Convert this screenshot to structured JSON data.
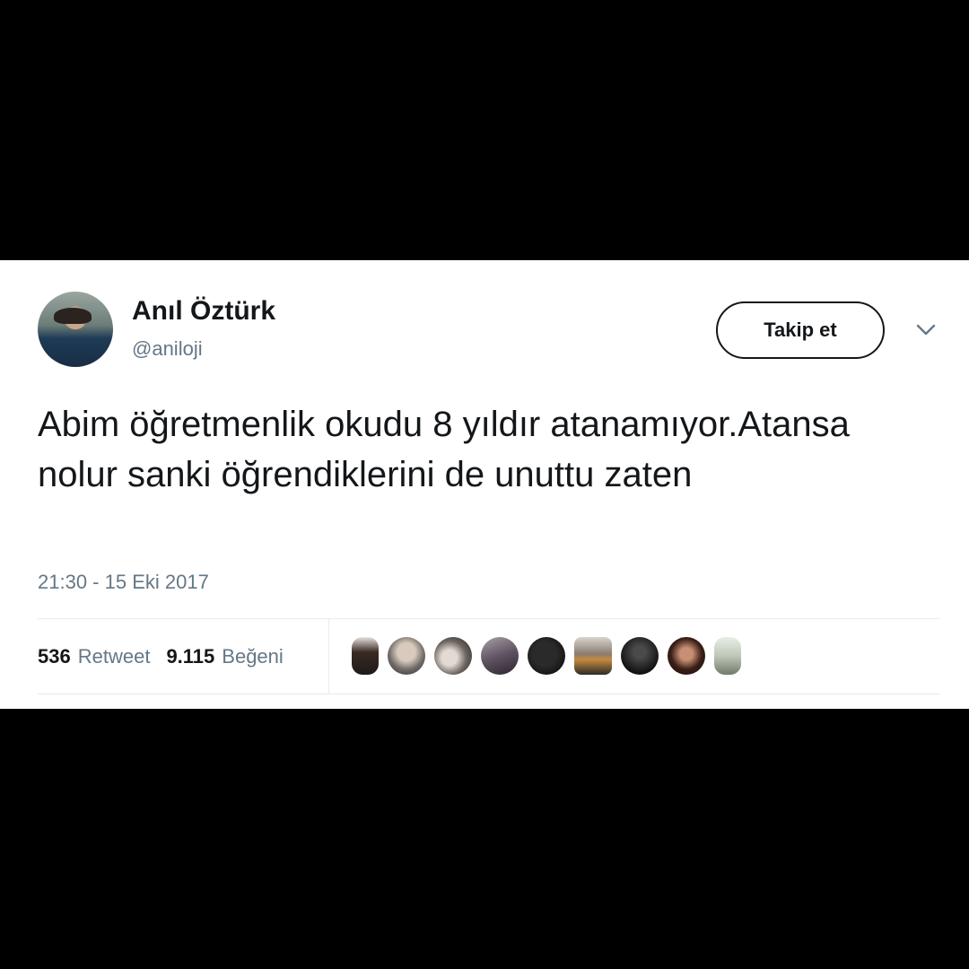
{
  "tweet": {
    "author": {
      "display_name": "Anıl Öztürk",
      "handle": "@aniloji"
    },
    "follow_button_label": "Takip et",
    "text": "Abim öğretmenlik okudu 8 yıldır atanamıyor.Atansa nolur sanki öğrendiklerini de unuttu zaten",
    "timestamp": "21:30 - 15 Eki 2017",
    "stats": {
      "retweets": {
        "count": "536",
        "label": "Retweet"
      },
      "likes": {
        "count": "9.115",
        "label": "Beğeni"
      }
    },
    "likers_count_shown": 9
  },
  "colors": {
    "primary_text": "#14171a",
    "secondary_text": "#657786",
    "divider": "#e6ecf0",
    "background": "#ffffff"
  },
  "icons": {
    "more_menu": "chevron-down-icon"
  }
}
